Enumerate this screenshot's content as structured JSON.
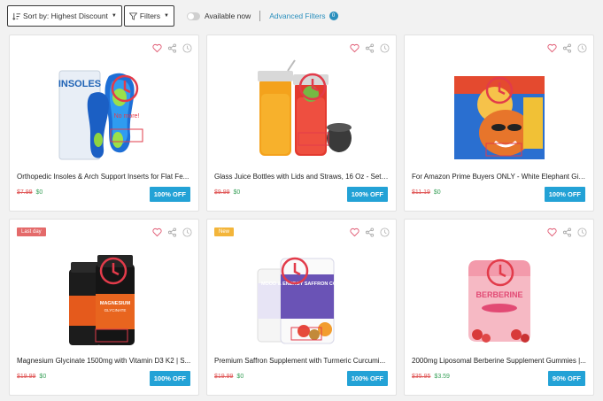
{
  "toolbar": {
    "sort_label": "Sort by: Highest Discount",
    "filters_label": "Filters",
    "available_now_label": "Available now",
    "advanced_filters_label": "Advanced Filters",
    "advanced_filters_count": "0"
  },
  "products": [
    {
      "title": "Orthopedic Insoles & Arch Support Inserts for Flat Fe...",
      "old_price": "$7.99",
      "new_price": "$0",
      "discount": "100% OFF",
      "tag": "",
      "overlay_text": "No more!"
    },
    {
      "title": "Glass Juice Bottles with Lids and Straws, 16 Oz - Set ...",
      "old_price": "$9.99",
      "new_price": "$0",
      "discount": "100% OFF",
      "tag": ""
    },
    {
      "title": "For Amazon Prime Buyers ONLY - White Elephant Gift...",
      "old_price": "$11.19",
      "new_price": "$0",
      "discount": "100% OFF",
      "tag": ""
    },
    {
      "title": "Magnesium Glycinate 1500mg with Vitamin D3 K2 | S...",
      "old_price": "$19.99",
      "new_price": "$0",
      "discount": "100% OFF",
      "tag": "Last day"
    },
    {
      "title": "Premium Saffron Supplement with Turmeric Curcumi...",
      "old_price": "$19.99",
      "new_price": "$0",
      "discount": "100% OFF",
      "tag": "New",
      "label_text": "MOOD & ENERGY SAFFRON COMPLEX"
    },
    {
      "title": "2000mg Liposomal Berberine Supplement Gummies |...",
      "old_price": "$35.95",
      "new_price": "$3.59",
      "discount": "90% OFF",
      "tag": "",
      "label_text": "BERBERINE"
    }
  ],
  "colors": {
    "accent": "#23a2d6",
    "old_price": "#e05a5a",
    "new_price": "#3aa15a",
    "tag_last_day": "#e46a6a",
    "tag_new": "#f3b53a"
  }
}
